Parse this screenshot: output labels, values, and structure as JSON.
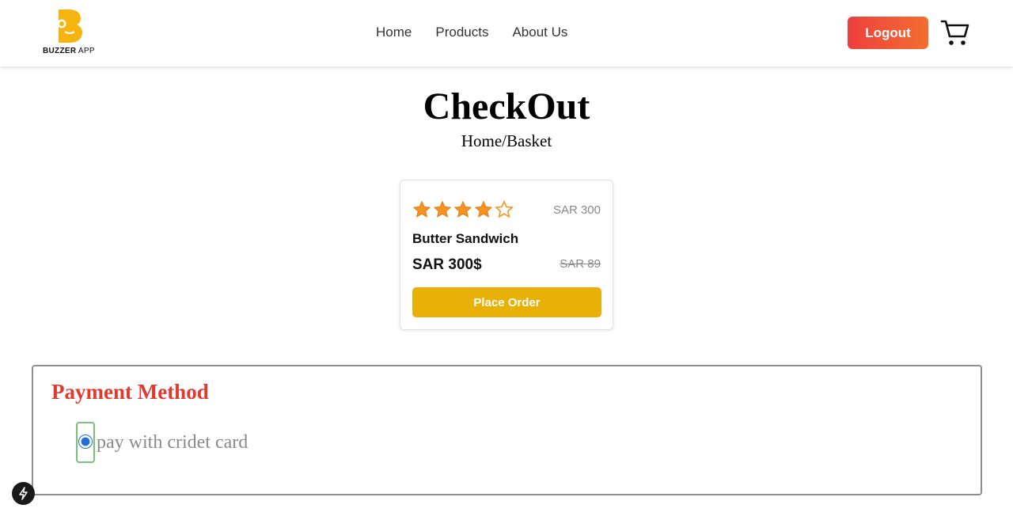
{
  "brand": {
    "name_bold": "BUZZER",
    "name_rest": " APP",
    "accent": "#f5b40f"
  },
  "nav": {
    "links": [
      "Home",
      "Products",
      "About Us"
    ],
    "logout_label": "Logout",
    "cart_icon": "cart-icon"
  },
  "page": {
    "title": "CheckOut",
    "breadcrumb": "Home/Basket"
  },
  "product": {
    "rating": 4,
    "rating_max": 5,
    "price_top": "SAR 300",
    "name": "Butter Sandwich",
    "price": "SAR 300$",
    "old_price": "SAR 89",
    "order_label": "Place Order",
    "button_color": "#e9b008"
  },
  "payment": {
    "title": "Payment Method",
    "option_label": "pay with cridet card",
    "option_selected": true,
    "title_color": "#e03a2e"
  },
  "colors": {
    "logout_gradient_start": "#ee3f3f",
    "logout_gradient_end": "#f36e30"
  }
}
